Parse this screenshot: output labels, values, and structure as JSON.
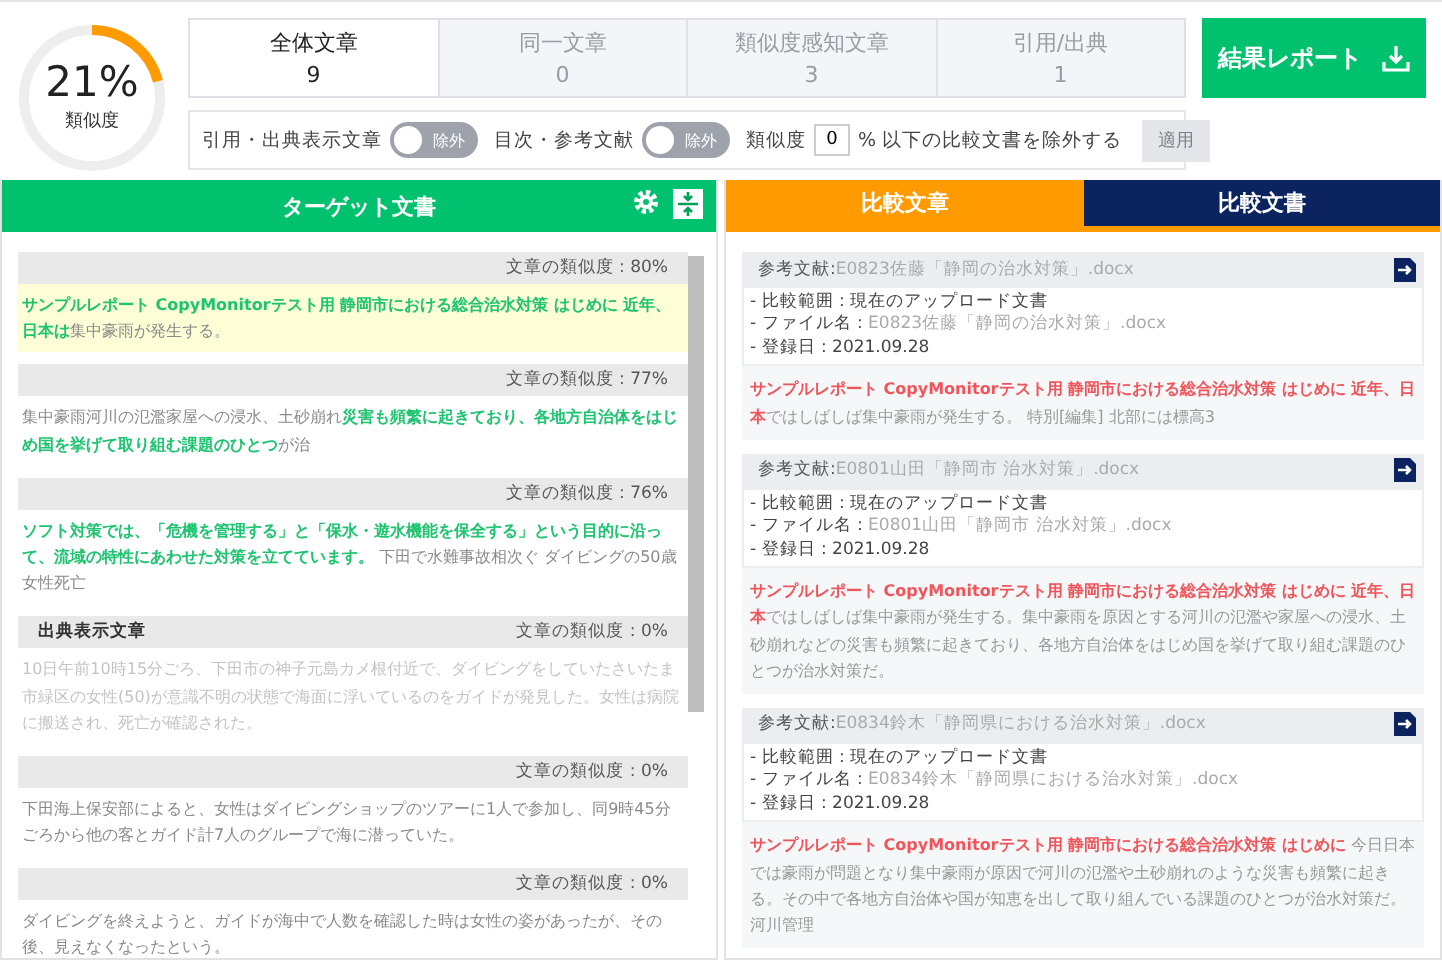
{
  "similarity": {
    "value": "21%",
    "label": "類似度",
    "level": 0.21
  },
  "tabs": [
    {
      "label": "全体文章",
      "count": "9",
      "selected": true
    },
    {
      "label": "同一文章",
      "count": "0",
      "selected": false
    },
    {
      "label": "類似度感知文章",
      "count": "3",
      "selected": false
    },
    {
      "label": "引用/出典",
      "count": "1",
      "selected": false
    }
  ],
  "report_button": "結果レポート",
  "filters": {
    "toggles": [
      {
        "label": "引用・出典表示文章",
        "state": "除外",
        "on": false
      },
      {
        "label": "目次・参考文献",
        "state": "除外",
        "on": false
      }
    ],
    "threshold": {
      "prefix": "類似度",
      "value": "0",
      "suffix": "% 以下の比較文書を除外する",
      "button": "適用",
      "disabled": true
    }
  },
  "target": {
    "title": "ターゲット文書",
    "sentences": [
      {
        "score": "文章の類似度 : 80%",
        "selected": true,
        "faded": false,
        "segments": [
          {
            "text": "サンプルレポート CopyMonitorテスト用 静岡市における総合治水対策 はじめに 近年、日本は",
            "match": true
          },
          {
            "text": "集中豪雨が発生する。",
            "match": false
          }
        ]
      },
      {
        "score": "文章の類似度 : 77%",
        "selected": false,
        "faded": false,
        "segments": [
          {
            "text": "集中豪雨河川の氾濫家屋への浸水、土砂崩れ",
            "match": false
          },
          {
            "text": "災害も頻繁に起きており、各地方自治体をはじめ国を挙げて取り組む課題のひとつ",
            "match": true
          },
          {
            "text": "が治",
            "match": false
          }
        ]
      },
      {
        "score": "文章の類似度 : 76%",
        "selected": false,
        "faded": false,
        "segments": [
          {
            "text": "ソフト対策では、「危機を管理する」と「保水・遊水機能を保全する」という目的に沿って、流域の特性にあわせた対策を立てています。",
            "match": true
          },
          {
            "text": " 下田で水難事故相次ぐ ダイビングの50歳女性死亡",
            "match": false
          }
        ]
      },
      {
        "label": "出典表示文章",
        "score": "文章の類似度 : 0%",
        "selected": false,
        "faded": true,
        "segments": [
          {
            "text": "10日午前10時15分ごろ、下田市の神子元島カメ根付近で、ダイビングをしていたさいたま市緑区の女性(50)が意識不明の状態で海面に浮いているのをガイドが発見した。女性は病院に搬送され、死亡が確認された。",
            "match": false
          }
        ]
      },
      {
        "score": "文章の類似度 : 0%",
        "selected": false,
        "faded": false,
        "segments": [
          {
            "text": "下田海上保安部によると、女性はダイビングショップのツアーに1人で参加し、同9時45分ごろから他の客とガイド計7人のグループで海に潜っていた。",
            "match": false
          }
        ]
      },
      {
        "score": "文章の類似度 : 0%",
        "selected": false,
        "faded": false,
        "segments": [
          {
            "text": "ダイビングを終えようと、ガイドが海中で人数を確認した時は女性の姿があったが、その後、見えなくなったという。",
            "match": false
          }
        ]
      }
    ]
  },
  "compare": {
    "tabs": [
      {
        "label": "比較文章",
        "selected": true
      },
      {
        "label": "比較文書",
        "selected": false
      }
    ],
    "cards": [
      {
        "ref_label": "参考文献:",
        "ref_name": "E0823佐藤「静岡の治水対策」.docx",
        "range": "- 比較範囲 : 現在のアップロード文書",
        "file_label": "- ファイル名 : ",
        "file_name": "E0823佐藤「静岡の治水対策」.docx",
        "date": "- 登録日 : 2021.09.28",
        "segments": [
          {
            "text": "サンプルレポート CopyMonitorテスト用 静岡市における総合治水対策 はじめに 近年、日本",
            "match": true
          },
          {
            "text": "ではしばしば集中豪雨が発生する。 特別[編集] 北部には標高3",
            "match": false
          }
        ]
      },
      {
        "ref_label": "参考文献:",
        "ref_name": "E0801山田「静岡市 治水対策」.docx",
        "range": "- 比較範囲 : 現在のアップロード文書",
        "file_label": "- ファイル名 : ",
        "file_name": "E0801山田「静岡市 治水対策」.docx",
        "date": "- 登録日 : 2021.09.28",
        "segments": [
          {
            "text": "サンプルレポート CopyMonitorテスト用 静岡市における総合治水対策 はじめに 近年、日本",
            "match": true
          },
          {
            "text": "ではしばしば集中豪雨が発生する。集中豪雨を原因とする河川の氾濫や家屋への浸水、土砂崩れなどの災害も頻繁に起きており、各地方自治体をはじめ国を挙げて取り組む課題のひとつが治水対策だ。",
            "match": false
          }
        ]
      },
      {
        "ref_label": "参考文献:",
        "ref_name": "E0834鈴木「静岡県における治水対策」.docx",
        "range": "- 比較範囲 : 現在のアップロード文書",
        "file_label": "- ファイル名 : ",
        "file_name": "E0834鈴木「静岡県における治水対策」.docx",
        "date": "- 登録日 : 2021.09.28",
        "segments": [
          {
            "text": "サンプルレポート CopyMonitorテスト用 静岡市における総合治水対策 はじめに",
            "match": true
          },
          {
            "text": " 今日日本では豪雨が問題となり集中豪雨が原因で河川の氾濫や土砂崩れのような災害も頻繁に起きる。その中で各地方自治体や国が知恵を出して取り組んでいる課題のひとつが治水対策だ。河川管理",
            "match": false
          }
        ]
      }
    ]
  }
}
